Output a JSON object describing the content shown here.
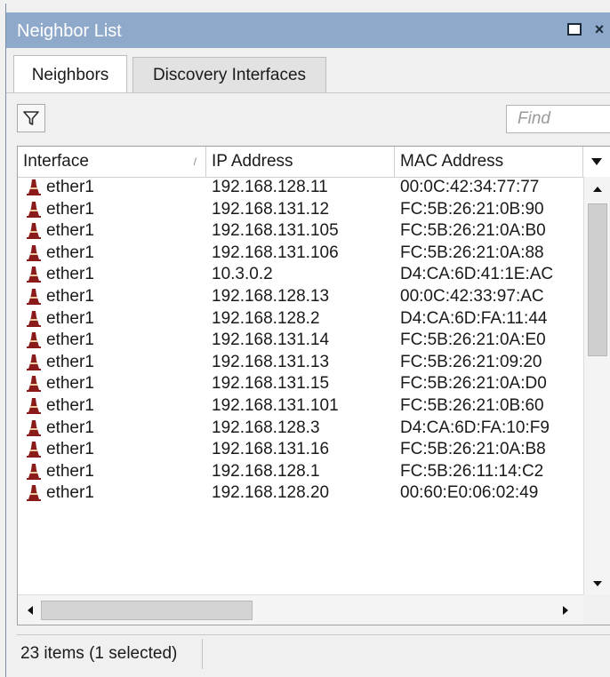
{
  "window": {
    "title": "Neighbor List",
    "close_label": "×"
  },
  "tabs": [
    {
      "label": "Neighbors",
      "active": true
    },
    {
      "label": "Discovery Interfaces",
      "active": false
    }
  ],
  "toolbar": {
    "filter_icon": "funnel-icon",
    "find_placeholder": "Find"
  },
  "table": {
    "columns": [
      "Interface",
      "IP Address",
      "MAC Address"
    ],
    "sort_indicator": "/",
    "rows": [
      {
        "interface": "ether1",
        "ip": "192.168.128.11",
        "mac": "00:0C:42:34:77:77"
      },
      {
        "interface": "ether1",
        "ip": "192.168.131.12",
        "mac": "FC:5B:26:21:0B:90"
      },
      {
        "interface": "ether1",
        "ip": "192.168.131.105",
        "mac": "FC:5B:26:21:0A:B0"
      },
      {
        "interface": "ether1",
        "ip": "192.168.131.106",
        "mac": "FC:5B:26:21:0A:88"
      },
      {
        "interface": "ether1",
        "ip": "10.3.0.2",
        "mac": "D4:CA:6D:41:1E:AC"
      },
      {
        "interface": "ether1",
        "ip": "192.168.128.13",
        "mac": "00:0C:42:33:97:AC"
      },
      {
        "interface": "ether1",
        "ip": "192.168.128.2",
        "mac": "D4:CA:6D:FA:11:44"
      },
      {
        "interface": "ether1",
        "ip": "192.168.131.14",
        "mac": "FC:5B:26:21:0A:E0"
      },
      {
        "interface": "ether1",
        "ip": "192.168.131.13",
        "mac": "FC:5B:26:21:09:20"
      },
      {
        "interface": "ether1",
        "ip": "192.168.131.15",
        "mac": "FC:5B:26:21:0A:D0"
      },
      {
        "interface": "ether1",
        "ip": "192.168.131.101",
        "mac": "FC:5B:26:21:0B:60"
      },
      {
        "interface": "ether1",
        "ip": "192.168.128.3",
        "mac": "D4:CA:6D:FA:10:F9"
      },
      {
        "interface": "ether1",
        "ip": "192.168.131.16",
        "mac": "FC:5B:26:21:0A:B8"
      },
      {
        "interface": "ether1",
        "ip": "192.168.128.1",
        "mac": "FC:5B:26:11:14:C2"
      },
      {
        "interface": "ether1",
        "ip": "192.168.128.20",
        "mac": "00:60:E0:06:02:49"
      }
    ]
  },
  "status": {
    "text": "23 items (1 selected)"
  },
  "colors": {
    "titlebar": "#8fa9cb",
    "interface_icon": "#8b1a1a"
  }
}
